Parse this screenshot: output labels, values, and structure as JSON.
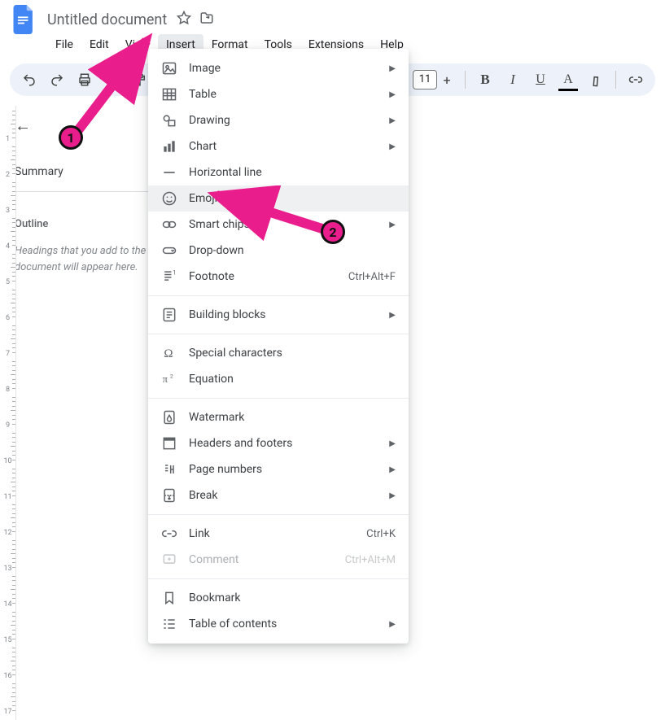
{
  "header": {
    "doc_title": "Untitled document"
  },
  "menubar": [
    "File",
    "Edit",
    "View",
    "Insert",
    "Format",
    "Tools",
    "Extensions",
    "Help"
  ],
  "menubar_active_index": 3,
  "toolbar": {
    "font_size": "11"
  },
  "sidebar": {
    "summary_label": "Summary",
    "outline_label": "Outline",
    "hint": "Headings that you add to the document will appear here."
  },
  "insert_menu": [
    {
      "type": "item",
      "icon": "image",
      "label": "Image",
      "submenu": true
    },
    {
      "type": "item",
      "icon": "table",
      "label": "Table",
      "submenu": true
    },
    {
      "type": "item",
      "icon": "drawing",
      "label": "Drawing",
      "submenu": true
    },
    {
      "type": "item",
      "icon": "chart",
      "label": "Chart",
      "submenu": true
    },
    {
      "type": "item",
      "icon": "hr",
      "label": "Horizontal line"
    },
    {
      "type": "item",
      "icon": "emoji",
      "label": "Emoji",
      "hover": true
    },
    {
      "type": "item",
      "icon": "chips",
      "label": "Smart chips",
      "submenu": true
    },
    {
      "type": "item",
      "icon": "dropdown",
      "label": "Drop-down"
    },
    {
      "type": "item",
      "icon": "footnote",
      "label": "Footnote",
      "shortcut": "Ctrl+Alt+F"
    },
    {
      "type": "divider"
    },
    {
      "type": "item",
      "icon": "blocks",
      "label": "Building blocks",
      "submenu": true
    },
    {
      "type": "divider"
    },
    {
      "type": "item",
      "icon": "omega",
      "label": "Special characters"
    },
    {
      "type": "item",
      "icon": "pi",
      "label": "Equation"
    },
    {
      "type": "divider"
    },
    {
      "type": "item",
      "icon": "watermark",
      "label": "Watermark"
    },
    {
      "type": "item",
      "icon": "headers",
      "label": "Headers and footers",
      "submenu": true
    },
    {
      "type": "item",
      "icon": "pagenum",
      "label": "Page numbers",
      "submenu": true
    },
    {
      "type": "item",
      "icon": "break",
      "label": "Break",
      "submenu": true
    },
    {
      "type": "divider"
    },
    {
      "type": "item",
      "icon": "link",
      "label": "Link",
      "shortcut": "Ctrl+K"
    },
    {
      "type": "item",
      "icon": "comment",
      "label": "Comment",
      "shortcut": "Ctrl+Alt+M",
      "disabled": true
    },
    {
      "type": "divider"
    },
    {
      "type": "item",
      "icon": "bookmark",
      "label": "Bookmark"
    },
    {
      "type": "item",
      "icon": "toc",
      "label": "Table of contents",
      "submenu": true
    }
  ],
  "annotations": {
    "one": "1",
    "two": "2"
  }
}
